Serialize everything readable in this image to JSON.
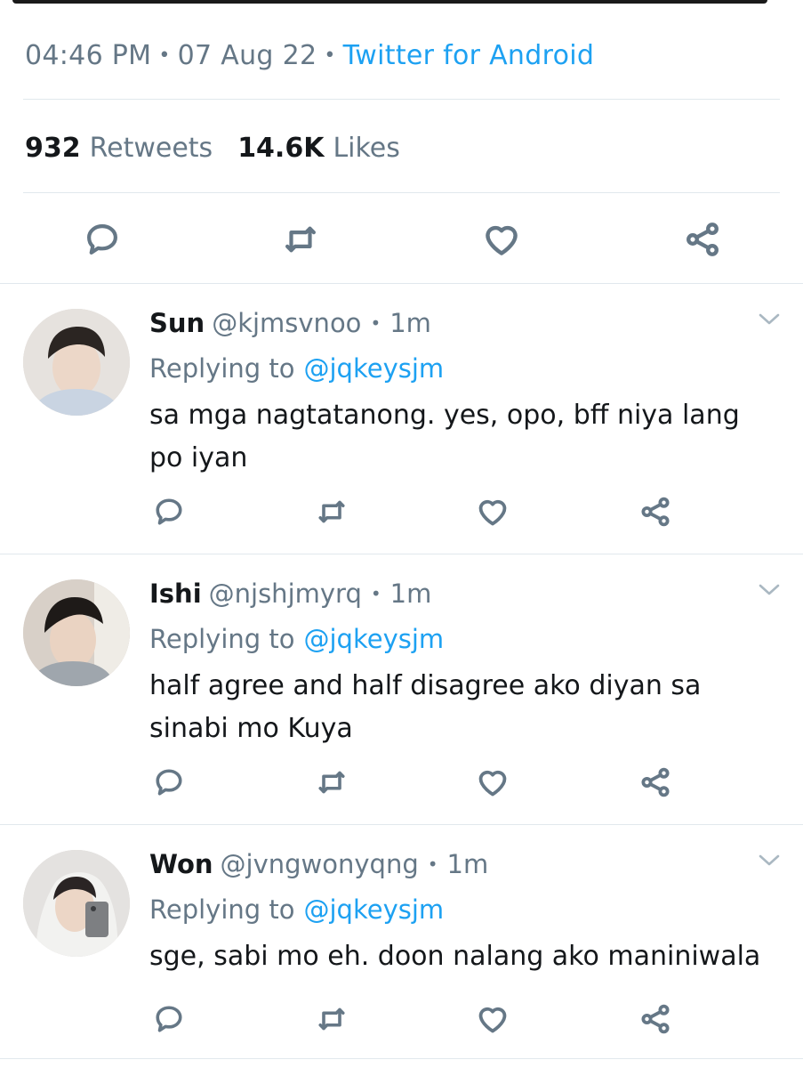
{
  "tweet": {
    "time": "04:46 PM",
    "date": "07 Aug 22",
    "source": "Twitter for Android",
    "retweets_count": "932",
    "retweets_label": "Retweets",
    "likes_count": "14.6K",
    "likes_label": "Likes"
  },
  "icons": {
    "reply": "reply-icon",
    "retweet": "retweet-icon",
    "like": "heart-icon",
    "share": "share-icon",
    "more": "chevron-down-icon"
  },
  "colors": {
    "link": "#1da1f2",
    "muted": "#657786",
    "text": "#14171a",
    "divider": "#e1e8ed"
  },
  "replies": [
    {
      "name": "Sun",
      "handle": "@kjmsvnoo",
      "time": "1m",
      "replying_label": "Replying to",
      "replying_to": "@jqkeysjm",
      "text": "sa mga nagtatanong. yes, opo, bff niya lang po iyan"
    },
    {
      "name": "Ishi",
      "handle": "@njshjmyrq",
      "time": "1m",
      "replying_label": "Replying to",
      "replying_to": "@jqkeysjm",
      "text": "half agree and half disagree ako diyan sa sinabi mo Kuya"
    },
    {
      "name": "Won",
      "handle": "@jvngwonyqng",
      "time": "1m",
      "replying_label": "Replying to",
      "replying_to": "@jqkeysjm",
      "text": "sge, sabi mo eh. doon nalang ako maniniwala"
    }
  ]
}
